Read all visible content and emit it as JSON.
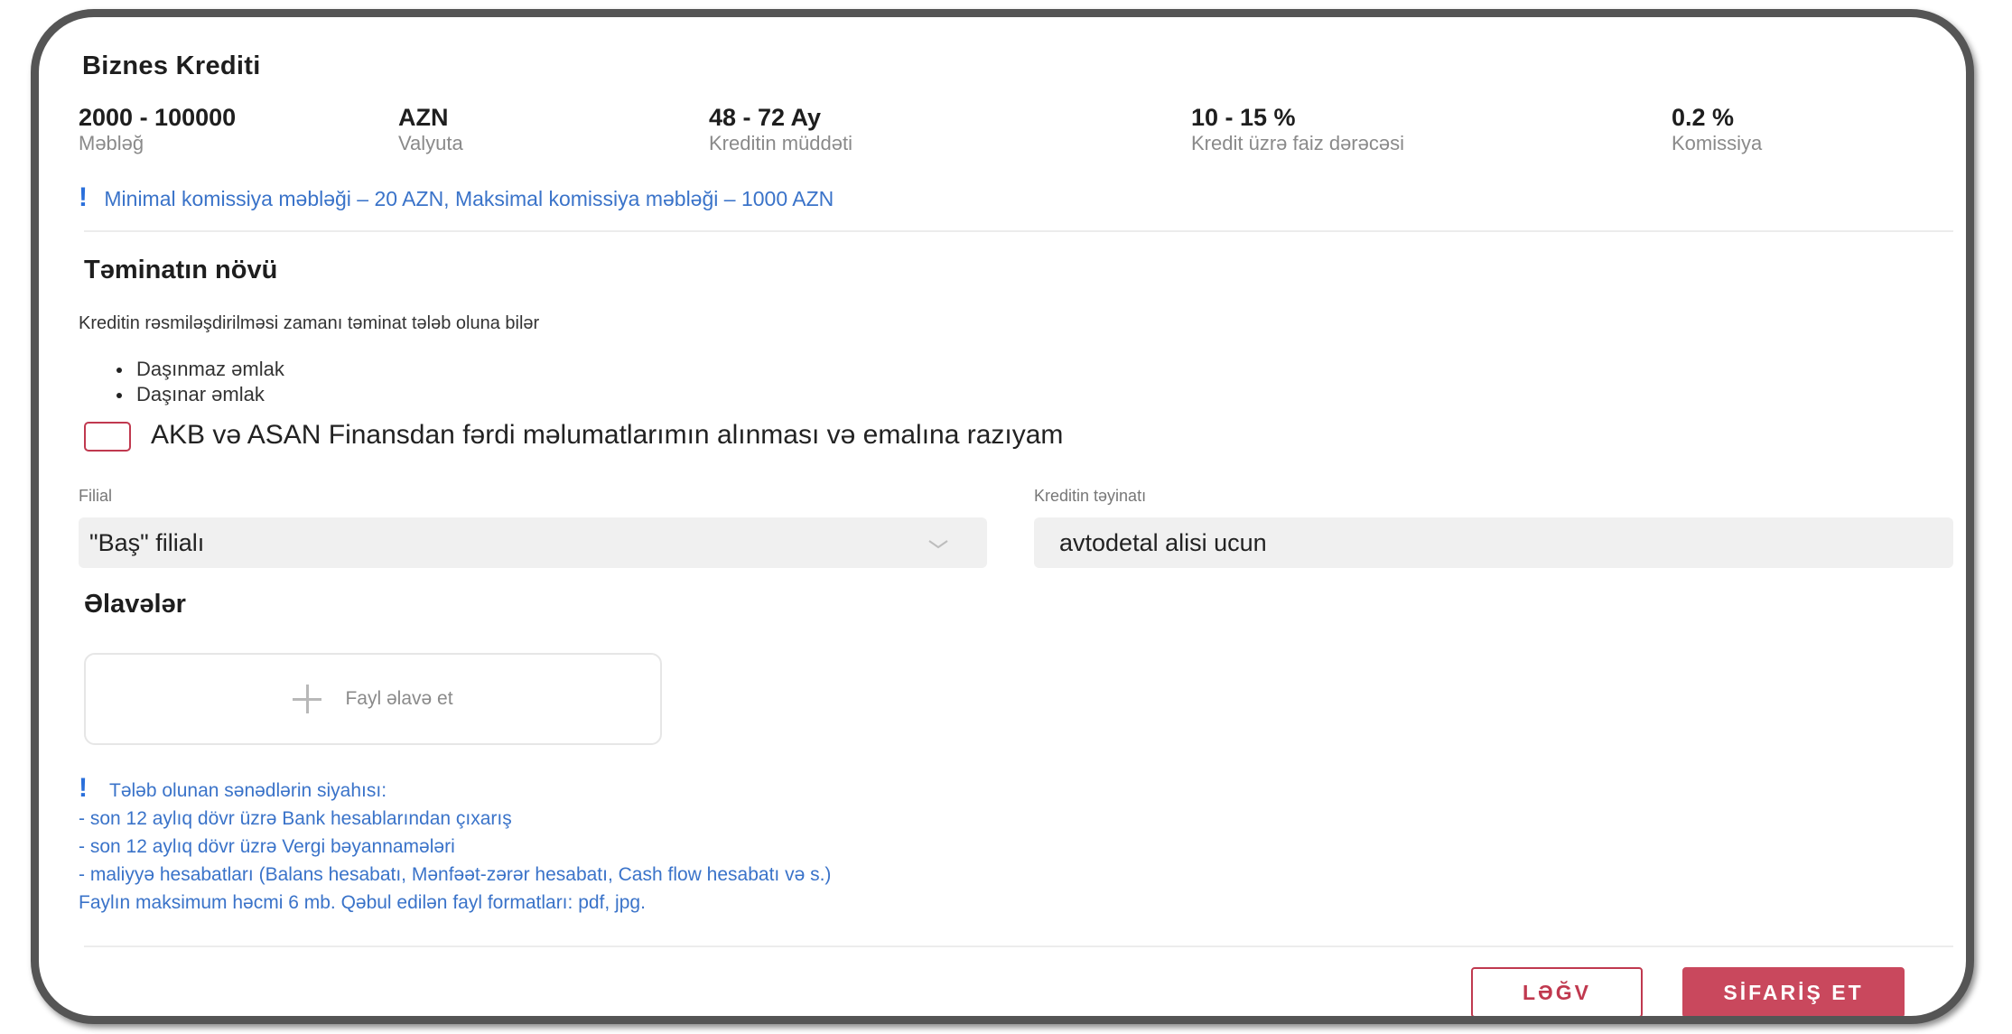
{
  "loan": {
    "title": "Biznes Krediti",
    "stats": [
      {
        "value": "2000 - 100000",
        "label": "Məbləğ"
      },
      {
        "value": "AZN",
        "label": "Valyuta"
      },
      {
        "value": "48 - 72 Ay",
        "label": "Kreditin müddəti"
      },
      {
        "value": "10 - 15 %",
        "label": "Kredit üzrə faiz dərəcəsi"
      },
      {
        "value": "0.2 %",
        "label": "Komissiya"
      }
    ],
    "commission_note": "Minimal komissiya məbləği – 20 AZN, Maksimal komissiya məbləği – 1000 AZN"
  },
  "collateral": {
    "title": "Təminatın növü",
    "description": "Kreditin rəsmiləşdirilməsi zamanı təminat tələb oluna bilər",
    "items": [
      "Daşınmaz əmlak",
      "Daşınar əmlak"
    ]
  },
  "consent": {
    "label": "AKB və ASAN Finansdan fərdi məlumatlarımın alınması və emalına razıyam",
    "checked": false
  },
  "form": {
    "branch": {
      "label": "Filial",
      "value": "\"Baş\" filialı"
    },
    "purpose": {
      "label": "Kreditin təyinatı",
      "value": "avtodetal alisi ucun"
    }
  },
  "attachments": {
    "title": "Əlavələr",
    "add_label": "Fayl əlavə et"
  },
  "requirements": {
    "heading": "Tələb olunan sənədlərin siyahısı:",
    "lines": [
      "- son 12 aylıq dövr üzrə Bank hesablarından çıxarış",
      "- son 12 aylıq dövr üzrə Vergi bəyannamələri",
      "- maliyyə hesabatları (Balans hesabatı, Mənfəət-zərər hesabatı, Cash flow hesabatı və s.)",
      "Faylın maksimum həcmi 6 mb. Qəbul edilən fayl formatları: pdf, jpg."
    ]
  },
  "actions": {
    "cancel": "LƏĞV",
    "submit": "SİFARİŞ ET"
  },
  "colors": {
    "accent": "#c9485d",
    "info": "#3a73c9"
  }
}
